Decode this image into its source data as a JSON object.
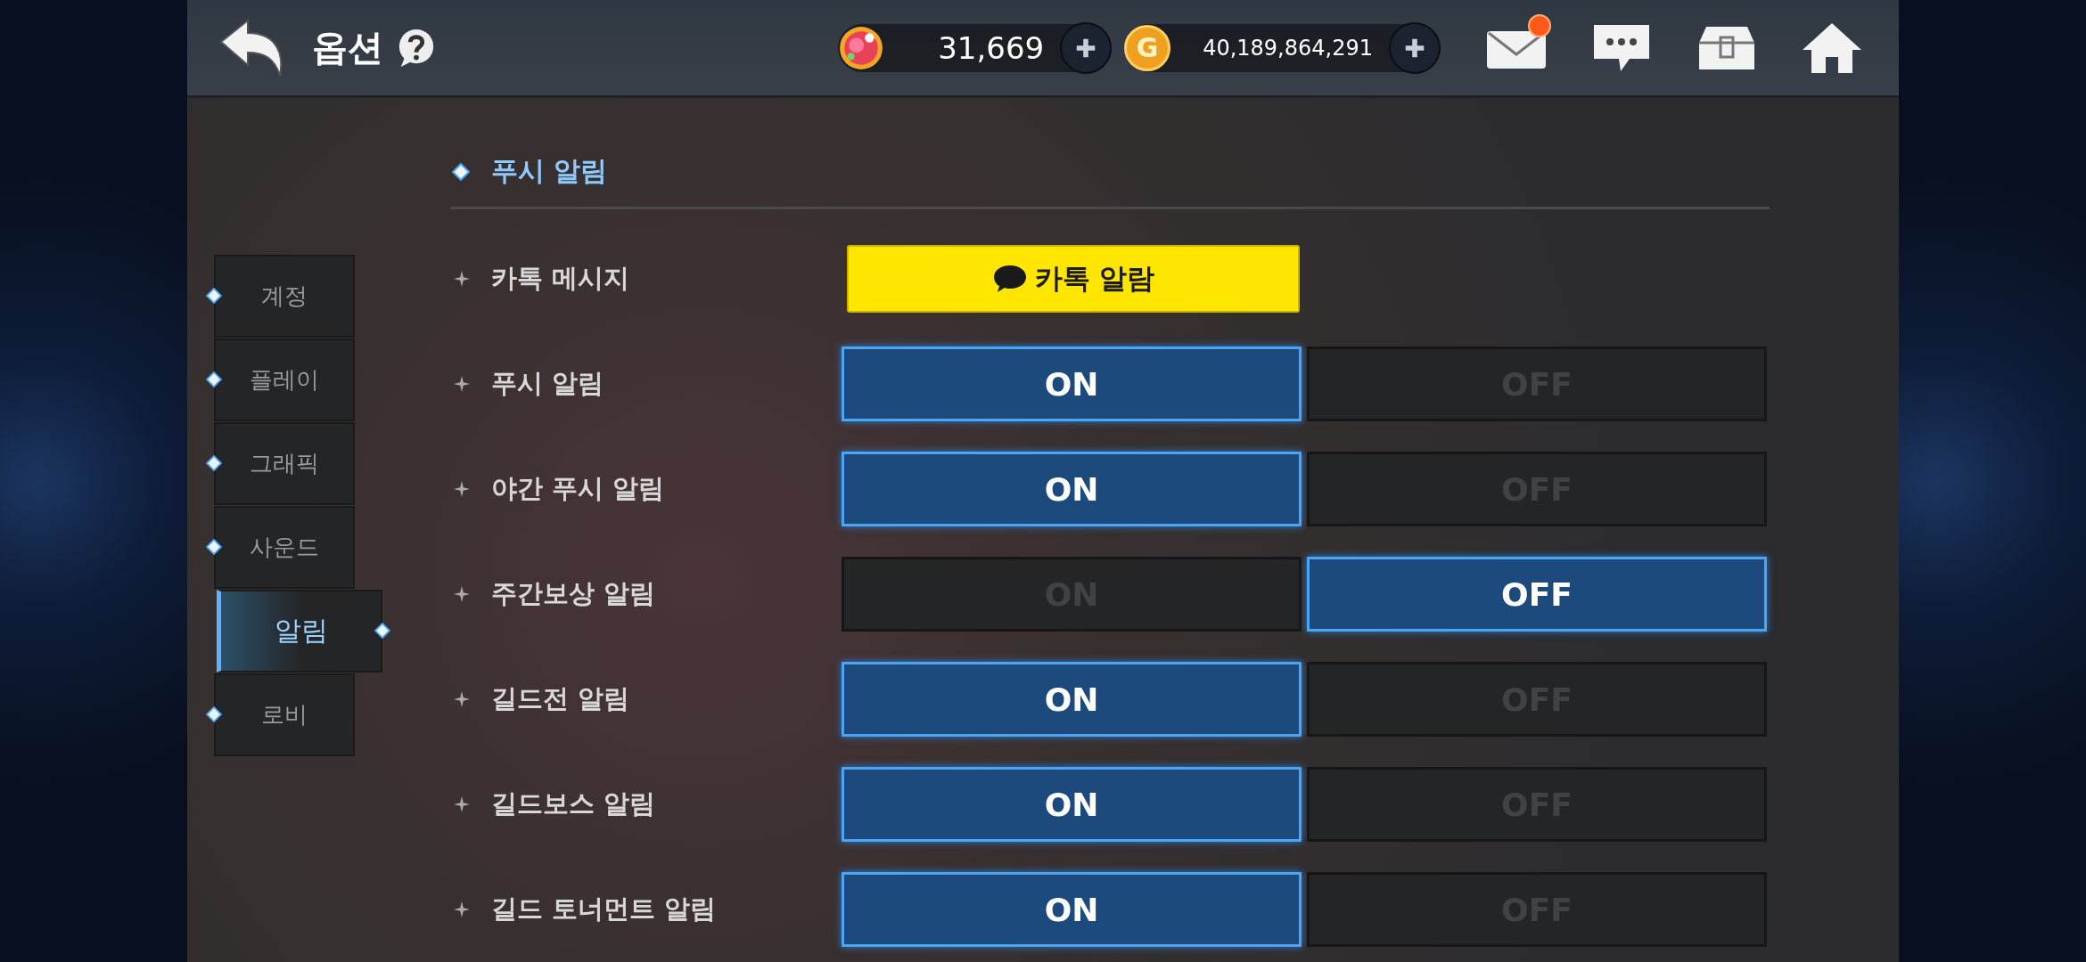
{
  "header": {
    "title": "옵션",
    "currencies": [
      {
        "kind": "gem",
        "value": "31,669"
      },
      {
        "kind": "gold",
        "value": "40,189,864,291",
        "coin_letter": "G"
      }
    ],
    "mail_unread": true
  },
  "sidebar": {
    "items": [
      {
        "label": "계정",
        "selected": false
      },
      {
        "label": "플레이",
        "selected": false
      },
      {
        "label": "그래픽",
        "selected": false
      },
      {
        "label": "사운드",
        "selected": false
      },
      {
        "label": "알림",
        "selected": true
      },
      {
        "label": "로비",
        "selected": false
      }
    ]
  },
  "section_title": "푸시 알림",
  "settings": [
    {
      "kind": "kakao",
      "label": "카톡 메시지",
      "button": "카톡 알람"
    },
    {
      "kind": "toggle",
      "label": "푸시 알림",
      "on_label": "ON",
      "off_label": "OFF",
      "on": true
    },
    {
      "kind": "toggle",
      "label": "야간 푸시 알림",
      "on_label": "ON",
      "off_label": "OFF",
      "on": true
    },
    {
      "kind": "toggle",
      "label": "주간보상 알림",
      "on_label": "ON",
      "off_label": "OFF",
      "on": false
    },
    {
      "kind": "toggle",
      "label": "길드전 알림",
      "on_label": "ON",
      "off_label": "OFF",
      "on": true
    },
    {
      "kind": "toggle",
      "label": "길드보스 알림",
      "on_label": "ON",
      "off_label": "OFF",
      "on": true
    },
    {
      "kind": "toggle",
      "label": "길드 토너먼트 알림",
      "on_label": "ON",
      "off_label": "OFF",
      "on": true
    }
  ]
}
